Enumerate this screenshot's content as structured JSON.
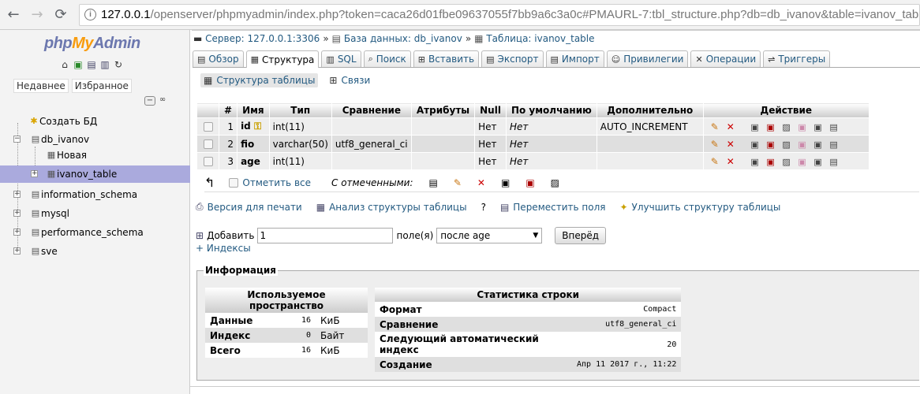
{
  "browser": {
    "url_host": "127.0.0.1",
    "url_path": "/openserver/phpmyadmin/index.php?token=caca26d01fbe09637055f7bb9a6c3a0c#PMAURL-7:tbl_structure.php?db=db_ivanov&table=ivanov_table&serve"
  },
  "left": {
    "logo_php": "php",
    "logo_my": "My",
    "logo_admin": "Admin",
    "tabs": [
      "Недавнее",
      "Избранное"
    ],
    "tree": [
      {
        "label": "Создать БД"
      },
      {
        "label": "db_ivanov"
      },
      {
        "label": "Новая"
      },
      {
        "label": "ivanov_table"
      },
      {
        "label": "information_schema"
      },
      {
        "label": "mysql"
      },
      {
        "label": "performance_schema"
      },
      {
        "label": "sve"
      }
    ]
  },
  "crumb": {
    "server": "Сервер: 127.0.0.1:3306",
    "db": "База данных: db_ivanov",
    "table": "Таблица: ivanov_table"
  },
  "tabs": [
    "Обзор",
    "Структура",
    "SQL",
    "Поиск",
    "Вставить",
    "Экспорт",
    "Импорт",
    "Привилегии",
    "Операции",
    "Триггеры"
  ],
  "subtabs": [
    "Структура таблицы",
    "Связи"
  ],
  "table": {
    "headers": [
      "#",
      "Имя",
      "Тип",
      "Сравнение",
      "Атрибуты",
      "Null",
      "По умолчанию",
      "Дополнительно",
      "Действие"
    ],
    "rows": [
      {
        "num": "1",
        "name": "id",
        "type": "int(11)",
        "collation": "",
        "attr": "",
        "null": "Нет",
        "default": "Нет",
        "extra": "AUTO_INCREMENT"
      },
      {
        "num": "2",
        "name": "fio",
        "type": "varchar(50)",
        "collation": "utf8_general_ci",
        "attr": "",
        "null": "Нет",
        "default": "Нет",
        "extra": ""
      },
      {
        "num": "3",
        "name": "age",
        "type": "int(11)",
        "collation": "",
        "attr": "",
        "null": "Нет",
        "default": "Нет",
        "extra": ""
      }
    ]
  },
  "checkall": {
    "label": "Отметить все",
    "with_selected": "С отмеченными:"
  },
  "links": [
    "Версия для печати",
    "Анализ структуры таблицы",
    "Переместить поля",
    "Улучшить структуру таблицы"
  ],
  "addrow": {
    "label": "Добавить",
    "value": "1",
    "fields_label": "поле(я)",
    "position": "после age",
    "go": "Вперёд",
    "indexes": "+ Индексы"
  },
  "info": {
    "legend": "Информация",
    "space_header": "Используемое пространство",
    "space": [
      {
        "label": "Данные",
        "value": "16",
        "unit": "КиБ"
      },
      {
        "label": "Индекс",
        "value": "0",
        "unit": "Байт"
      },
      {
        "label": "Всего",
        "value": "16",
        "unit": "КиБ"
      }
    ],
    "stats_header": "Статистика строки",
    "stats": [
      {
        "label": "Формат",
        "value": "Compact"
      },
      {
        "label": "Сравнение",
        "value": "utf8_general_ci"
      },
      {
        "label": "Следующий автоматический индекс",
        "value": "20"
      },
      {
        "label": "Создание",
        "value": "Апр 11 2017 г., 11:22"
      }
    ]
  }
}
